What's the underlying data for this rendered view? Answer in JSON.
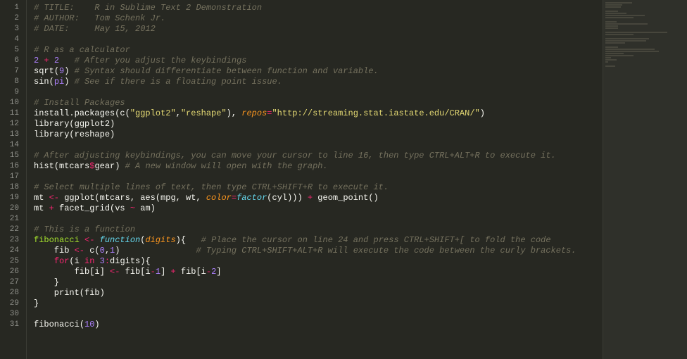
{
  "editor": {
    "line_count": 31,
    "lines": [
      {
        "n": 1,
        "tokens": [
          {
            "t": "# TITLE:    R in Sublime Text 2 Demonstration",
            "c": "c"
          }
        ]
      },
      {
        "n": 2,
        "tokens": [
          {
            "t": "# AUTHOR:   Tom Schenk Jr.",
            "c": "c"
          }
        ]
      },
      {
        "n": 3,
        "tokens": [
          {
            "t": "# DATE:     May 15, 2012",
            "c": "c"
          }
        ]
      },
      {
        "n": 4,
        "tokens": []
      },
      {
        "n": 5,
        "tokens": [
          {
            "t": "# R as a calculator",
            "c": "c"
          }
        ]
      },
      {
        "n": 6,
        "tokens": [
          {
            "t": "2",
            "c": "n"
          },
          {
            "t": " ",
            "c": "p"
          },
          {
            "t": "+",
            "c": "k"
          },
          {
            "t": " ",
            "c": "p"
          },
          {
            "t": "2",
            "c": "n"
          },
          {
            "t": "   ",
            "c": "p"
          },
          {
            "t": "# After you adjust the keybindings",
            "c": "c"
          }
        ]
      },
      {
        "n": 7,
        "tokens": [
          {
            "t": "sqrt",
            "c": "f"
          },
          {
            "t": "(",
            "c": "p"
          },
          {
            "t": "9",
            "c": "n"
          },
          {
            "t": ") ",
            "c": "p"
          },
          {
            "t": "# Syntax should differentiate between function and variable.",
            "c": "c"
          }
        ]
      },
      {
        "n": 8,
        "tokens": [
          {
            "t": "sin",
            "c": "f"
          },
          {
            "t": "(",
            "c": "p"
          },
          {
            "t": "pi",
            "c": "n"
          },
          {
            "t": ") ",
            "c": "p"
          },
          {
            "t": "# See if there is a floating point issue.",
            "c": "c"
          }
        ]
      },
      {
        "n": 9,
        "tokens": []
      },
      {
        "n": 10,
        "tokens": [
          {
            "t": "# Install Packages",
            "c": "c"
          }
        ]
      },
      {
        "n": 11,
        "tokens": [
          {
            "t": "install.packages",
            "c": "f"
          },
          {
            "t": "(",
            "c": "p"
          },
          {
            "t": "c",
            "c": "f"
          },
          {
            "t": "(",
            "c": "p"
          },
          {
            "t": "\"ggplot2\"",
            "c": "s"
          },
          {
            "t": ",",
            "c": "p"
          },
          {
            "t": "\"reshape\"",
            "c": "s"
          },
          {
            "t": ")",
            "c": "p"
          },
          {
            "t": ", ",
            "c": "p"
          },
          {
            "t": "repos",
            "c": "kc"
          },
          {
            "t": "=",
            "c": "k"
          },
          {
            "t": "\"http://streaming.stat.iastate.edu/CRAN/\"",
            "c": "s"
          },
          {
            "t": ")",
            "c": "p"
          }
        ]
      },
      {
        "n": 12,
        "tokens": [
          {
            "t": "library",
            "c": "f"
          },
          {
            "t": "(ggplot2)",
            "c": "p"
          }
        ]
      },
      {
        "n": 13,
        "tokens": [
          {
            "t": "library",
            "c": "f"
          },
          {
            "t": "(reshape)",
            "c": "p"
          }
        ]
      },
      {
        "n": 14,
        "tokens": []
      },
      {
        "n": 15,
        "tokens": [
          {
            "t": "# After adjusting keybindings, you can move your cursor to line 16, then type CTRL+ALT+R to execute it.",
            "c": "c"
          }
        ]
      },
      {
        "n": 16,
        "tokens": [
          {
            "t": "hist",
            "c": "f"
          },
          {
            "t": "(mtcars",
            "c": "p"
          },
          {
            "t": "$",
            "c": "d"
          },
          {
            "t": "gear) ",
            "c": "p"
          },
          {
            "t": "# A new window will open with the graph.",
            "c": "c"
          }
        ]
      },
      {
        "n": 17,
        "tokens": []
      },
      {
        "n": 18,
        "tokens": [
          {
            "t": "# Select multiple lines of text, then type CTRL+SHIFT+R to execute it.",
            "c": "c"
          }
        ]
      },
      {
        "n": 19,
        "tokens": [
          {
            "t": "mt ",
            "c": "p"
          },
          {
            "t": "<-",
            "c": "k"
          },
          {
            "t": " ggplot(mtcars, aes(mpg, wt, ",
            "c": "p"
          },
          {
            "t": "color",
            "c": "kc"
          },
          {
            "t": "=",
            "c": "k"
          },
          {
            "t": "factor",
            "c": "fd"
          },
          {
            "t": "(cyl))) ",
            "c": "p"
          },
          {
            "t": "+",
            "c": "k"
          },
          {
            "t": " geom_point()",
            "c": "p"
          }
        ]
      },
      {
        "n": 20,
        "tokens": [
          {
            "t": "mt ",
            "c": "p"
          },
          {
            "t": "+",
            "c": "k"
          },
          {
            "t": " facet_grid(vs ",
            "c": "p"
          },
          {
            "t": "~",
            "c": "k"
          },
          {
            "t": " am)",
            "c": "p"
          }
        ]
      },
      {
        "n": 21,
        "tokens": []
      },
      {
        "n": 22,
        "tokens": [
          {
            "t": "# This is a function",
            "c": "c"
          }
        ]
      },
      {
        "n": 23,
        "tokens": [
          {
            "t": "fibonacci",
            "c": "fn"
          },
          {
            "t": " ",
            "c": "p"
          },
          {
            "t": "<-",
            "c": "k"
          },
          {
            "t": " ",
            "c": "p"
          },
          {
            "t": "function",
            "c": "fd"
          },
          {
            "t": "(",
            "c": "p"
          },
          {
            "t": "digits",
            "c": "param"
          },
          {
            "t": "){   ",
            "c": "p"
          },
          {
            "t": "# Place the cursor on line 24 and press CTRL+SHIFT+[ to fold the code",
            "c": "c"
          }
        ]
      },
      {
        "n": 24,
        "tokens": [
          {
            "t": "    fib ",
            "c": "p"
          },
          {
            "t": "<-",
            "c": "k"
          },
          {
            "t": " c(",
            "c": "p"
          },
          {
            "t": "0",
            "c": "n"
          },
          {
            "t": ",",
            "c": "p"
          },
          {
            "t": "1",
            "c": "n"
          },
          {
            "t": ")               ",
            "c": "p"
          },
          {
            "t": "# Typing CTRL+SHIFT+ALT+R will execute the code between the curly brackets.",
            "c": "c"
          }
        ]
      },
      {
        "n": 25,
        "tokens": [
          {
            "t": "    ",
            "c": "p"
          },
          {
            "t": "for",
            "c": "k"
          },
          {
            "t": "(i ",
            "c": "p"
          },
          {
            "t": "in",
            "c": "k"
          },
          {
            "t": " ",
            "c": "p"
          },
          {
            "t": "3",
            "c": "n"
          },
          {
            "t": ":",
            "c": "k"
          },
          {
            "t": "digits){",
            "c": "p"
          }
        ]
      },
      {
        "n": 26,
        "tokens": [
          {
            "t": "        fib[i] ",
            "c": "p"
          },
          {
            "t": "<-",
            "c": "k"
          },
          {
            "t": " fib[i",
            "c": "p"
          },
          {
            "t": "-",
            "c": "k"
          },
          {
            "t": "1",
            "c": "n"
          },
          {
            "t": "] ",
            "c": "p"
          },
          {
            "t": "+",
            "c": "k"
          },
          {
            "t": " fib[i",
            "c": "p"
          },
          {
            "t": "-",
            "c": "k"
          },
          {
            "t": "2",
            "c": "n"
          },
          {
            "t": "]",
            "c": "p"
          }
        ]
      },
      {
        "n": 27,
        "tokens": [
          {
            "t": "    }",
            "c": "p"
          }
        ]
      },
      {
        "n": 28,
        "tokens": [
          {
            "t": "    print(fib)",
            "c": "p"
          }
        ]
      },
      {
        "n": 29,
        "tokens": [
          {
            "t": "}",
            "c": "p"
          }
        ]
      },
      {
        "n": 30,
        "tokens": []
      },
      {
        "n": 31,
        "tokens": [
          {
            "t": "fibonacci",
            "c": "f"
          },
          {
            "t": "(",
            "c": "p"
          },
          {
            "t": "10",
            "c": "n"
          },
          {
            "t": ")",
            "c": "p"
          }
        ]
      }
    ]
  },
  "minimap": {
    "widths": [
      38,
      24,
      22,
      0,
      18,
      30,
      56,
      40,
      0,
      16,
      60,
      18,
      18,
      0,
      88,
      40,
      0,
      62,
      58,
      28,
      0,
      18,
      70,
      76,
      26,
      40,
      8,
      16,
      4,
      0,
      14
    ]
  }
}
